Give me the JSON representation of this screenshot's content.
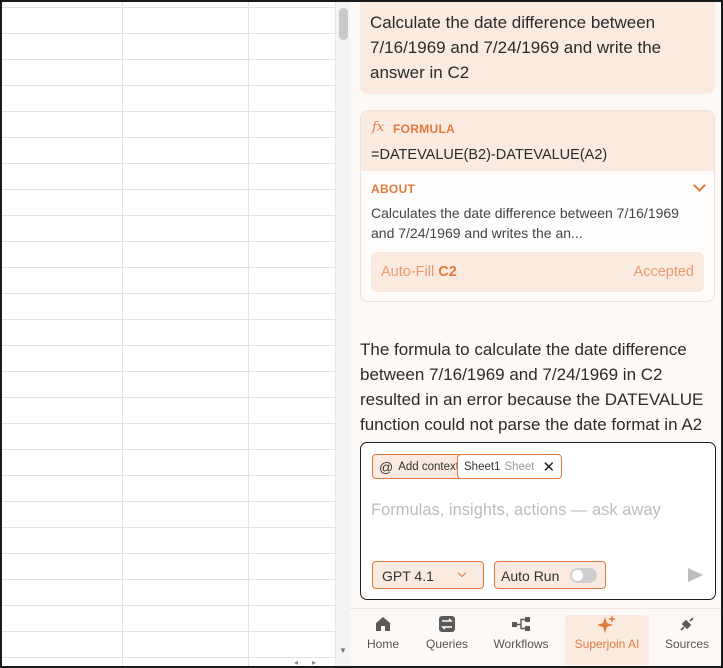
{
  "user_message": "Calculate the date difference between 7/16/1969 and 7/24/1969 and write the answer in C2",
  "formula_card": {
    "formula_title": "FORMULA",
    "formula": "=DATEVALUE(B2)-DATEVALUE(A2)",
    "about_title": "ABOUT",
    "about_text": "Calculates the date difference between 7/16/1969 and 7/24/1969 and writes the an...",
    "autofill_prefix": "Auto-Fill ",
    "autofill_cell": "C2",
    "autofill_status": "Accepted"
  },
  "ai_response": "The formula to calculate the date difference between 7/16/1969 and 7/24/1969 in C2 resulted in an error because the DATEVALUE function could not parse the date format in A2",
  "composer": {
    "add_context_label": "Add context",
    "sheet_chip_name": "Sheet1",
    "sheet_chip_kind": "Sheet",
    "placeholder": "Formulas, insights, actions — ask away",
    "model": "GPT 4.1",
    "auto_run_label": "Auto Run",
    "auto_run_enabled": false
  },
  "nav": {
    "items": [
      {
        "label": "Home",
        "icon": "home-icon",
        "active": false
      },
      {
        "label": "Queries",
        "icon": "swap-icon",
        "active": false
      },
      {
        "label": "Workflows",
        "icon": "workflow-icon",
        "active": false
      },
      {
        "label": "Superjoin AI",
        "icon": "sparkle-icon",
        "active": true
      },
      {
        "label": "Sources",
        "icon": "plug-icon",
        "active": false
      }
    ]
  },
  "colors": {
    "accent": "#e07b3f",
    "accent_bg": "#fbeadf",
    "panel_bg": "#fdf9f6"
  }
}
